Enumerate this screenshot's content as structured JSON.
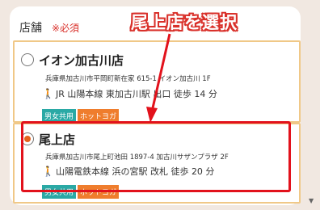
{
  "header": {
    "label": "店舗",
    "required": "※必須"
  },
  "annotation": {
    "text": "尾上店を選択"
  },
  "stores": [
    {
      "name": "イオン加古川店",
      "address": "兵庫県加古川市平岡町新在家 615-1 イオン加古川 1F",
      "access": "JR 山陽本線 東加古川駅 出口 徒歩 14 分",
      "badges": [
        "男女共用",
        "ホットヨガ"
      ],
      "selected": false
    },
    {
      "name": "尾上店",
      "address": "兵庫県加古川市尾上町池田 1897-4 加古川サザンプラザ 2F",
      "access": "山陽電鉄本線 浜の宮駅 改札 徒歩 20 分",
      "badges": [
        "男女共用",
        "ホットヨガ"
      ],
      "selected": true
    }
  ],
  "colors": {
    "accent_red": "#e2121c",
    "radio_selected": "#e3621f",
    "badge_teal": "#2aa9a5",
    "badge_orange": "#ef7d2d",
    "card_border": "#f0c887"
  },
  "icons": {
    "walk": "walking-person-icon",
    "scroll": "scroll-down-icon"
  }
}
